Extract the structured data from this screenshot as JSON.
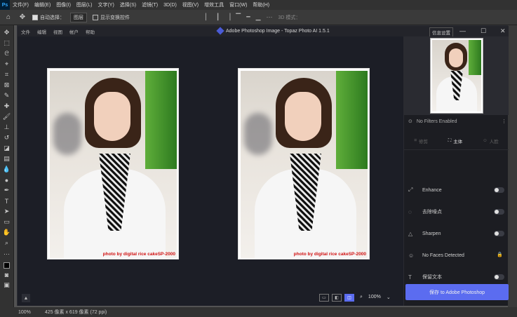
{
  "ps": {
    "menu": [
      "文件(F)",
      "编辑(E)",
      "图像(I)",
      "图层(L)",
      "文字(Y)",
      "选择(S)",
      "滤镜(T)",
      "3D(D)",
      "视图(V)",
      "增效工具",
      "窗口(W)",
      "帮助(H)"
    ],
    "options": {
      "auto_select_label": "自动选择：",
      "auto_select_value": "图层",
      "show_transform_label": "显示变换控件",
      "mode_label": "3D 模式："
    },
    "status": {
      "zoom": "100%",
      "doc_info": "425 像素 x 619 像素 (72 ppi)"
    }
  },
  "topaz": {
    "title": "Adobe Photoshop Image - Topaz Photo AI 1.5.1",
    "menu": [
      "文件",
      "编辑",
      "视图",
      "帐户",
      "帮助"
    ],
    "info_button": "信息设置",
    "caption": "photo by digital rice cakeSP-2000",
    "zoom": "100%",
    "no_filters": "No Filters Enabled",
    "tabs": [
      {
        "label": "修剪"
      },
      {
        "label": "主体"
      },
      {
        "label": "人脸"
      }
    ],
    "filters": [
      {
        "label": "Enhance"
      },
      {
        "label": "去除噪点"
      },
      {
        "label": "Sharpen"
      },
      {
        "label": "No Faces Detected"
      },
      {
        "label": "保留文本"
      }
    ],
    "save_label": "保存 to Adobe Photoshop",
    "accent": "#5b6cf0"
  }
}
